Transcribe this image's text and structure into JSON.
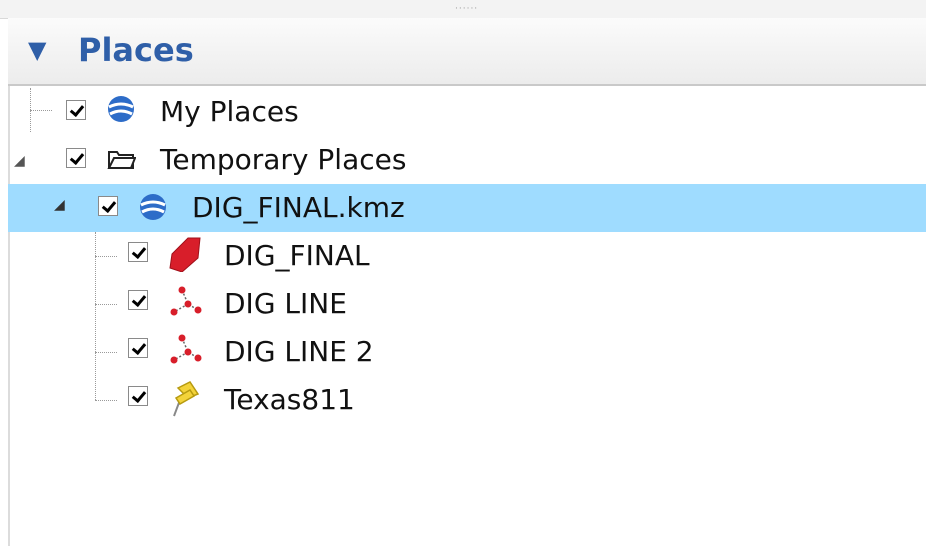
{
  "panel": {
    "title": "Places"
  },
  "tree": {
    "my_places": "My Places",
    "temporary_places": "Temporary Places",
    "kmz": "DIG_FINAL.kmz",
    "children": [
      "DIG_FINAL",
      "DIG LINE",
      "DIG LINE 2",
      "Texas811"
    ]
  },
  "colors": {
    "selection": "#9fdcff",
    "title": "#2f5fa8",
    "polygon": "#d81e2a",
    "pin": "#f3d33a"
  }
}
